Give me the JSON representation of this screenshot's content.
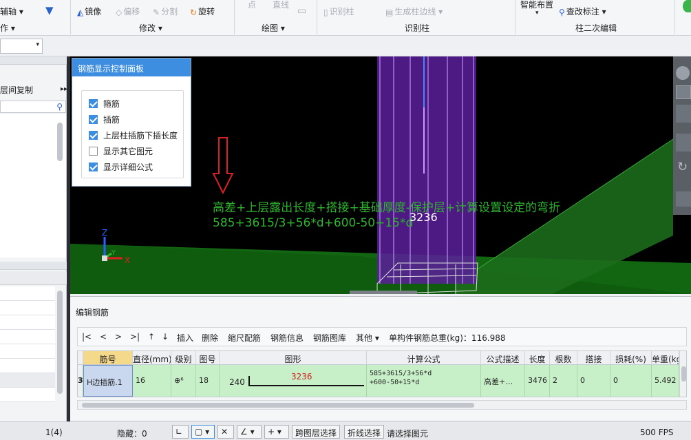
{
  "ribbon": {
    "aux_axis": "辅轴",
    "work_partial": "作",
    "mirror": "镜像",
    "offset": "偏移",
    "split": "分割",
    "rotate": "旋转",
    "modify_group": "修改",
    "point": "点",
    "line": "直线",
    "draw_group": "绘图",
    "identify_column": "识别柱",
    "generate_edge": "生成柱边线",
    "identify_group": "识别柱",
    "smart_layout": "智能布置",
    "check_label": "查改标注",
    "secondary_group": "柱二次编辑"
  },
  "left_panel": {
    "copy_between_floors": "层间复制"
  },
  "control_panel": {
    "title": "钢筋显示控制面板",
    "options": [
      {
        "label": "箍筋",
        "checked": true
      },
      {
        "label": "插筋",
        "checked": true
      },
      {
        "label": "上层柱插筋下插长度",
        "checked": true
      },
      {
        "label": "显示其它图元",
        "checked": false
      },
      {
        "label": "显示详细公式",
        "checked": true
      }
    ]
  },
  "viewport": {
    "formula_text": "高差+上层露出长度+搭接+基础厚度-保护层+计算设置设定的弯折",
    "formula_values": "585+3615/3+56*d+600-50+15*d",
    "length_label": "3236",
    "axis_z": "Z",
    "axis_y": "Y",
    "axis_x": "X"
  },
  "edit_panel": {
    "title": "编辑钢筋",
    "toolbar": {
      "first": "|<",
      "prev": "<",
      "next": ">",
      "last": ">|",
      "up": "↑",
      "down": "↓",
      "insert": "插入",
      "delete": "删除",
      "scale_rebar": "缩尺配筋",
      "rebar_info": "钢筋信息",
      "rebar_library": "钢筋图库",
      "other": "其他",
      "total_weight": "单构件钢筋总重(kg)：116.988"
    },
    "table": {
      "columns": [
        "筋号",
        "直径(mm)",
        "级别",
        "图号",
        "图形",
        "计算公式",
        "公式描述",
        "长度",
        "根数",
        "搭接",
        "损耗(%)",
        "单重(kg)"
      ],
      "row": {
        "index": "3",
        "name": "H边插筋.1",
        "diameter": "16",
        "grade": "⊕⁶",
        "figure_no": "18",
        "shape_left": "240",
        "shape_value": "3236",
        "formula_line1": "585+3615/3+56*d",
        "formula_line2": "+600-50+15*d",
        "description": "高差+…",
        "length": "3476",
        "count": "2",
        "overlap": "0",
        "loss": "0",
        "unit_weight": "5.492"
      }
    }
  },
  "status_bar": {
    "page": "1(4)",
    "hidden": "隐藏：0",
    "cross_floor_select": "跨图层选择",
    "polyline_select": "折线选择",
    "prompt": "请选择图元",
    "fps": "500 FPS"
  },
  "colors": {
    "accent": "#3d8ee0",
    "formula_green": "#2fb32f",
    "arrow_red": "#e02020",
    "rebar_purple": "#9b3fe0",
    "row_green": "#c8f0c8"
  }
}
